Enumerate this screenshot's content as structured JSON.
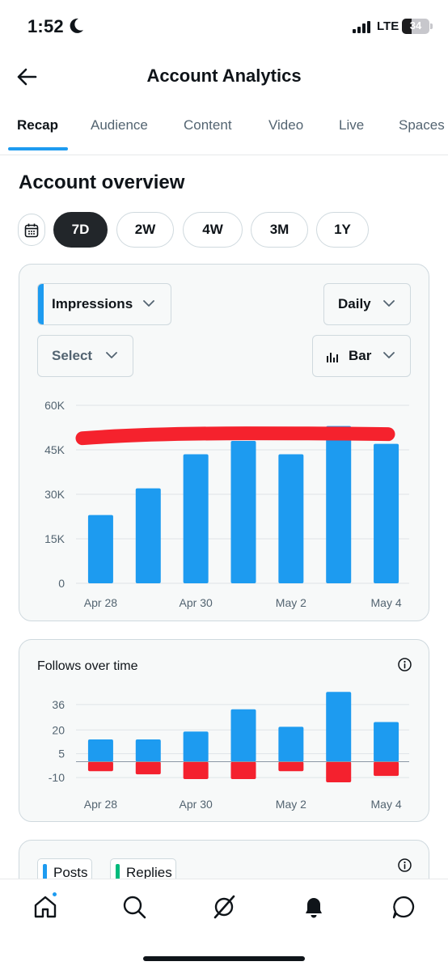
{
  "status_bar": {
    "time": "1:52",
    "network": "LTE",
    "battery": "34",
    "battery_level": 0.34
  },
  "header": {
    "title": "Account Analytics",
    "back_icon": "arrow-left-icon"
  },
  "tabs": [
    {
      "label": "Recap",
      "active": true
    },
    {
      "label": "Audience",
      "active": false
    },
    {
      "label": "Content",
      "active": false
    },
    {
      "label": "Video",
      "active": false
    },
    {
      "label": "Live",
      "active": false
    },
    {
      "label": "Spaces",
      "active": false
    }
  ],
  "overview": {
    "title": "Account overview",
    "ranges": [
      {
        "label": "7D",
        "selected": true
      },
      {
        "label": "2W",
        "selected": false
      },
      {
        "label": "4W",
        "selected": false
      },
      {
        "label": "3M",
        "selected": false
      },
      {
        "label": "1Y",
        "selected": false
      }
    ]
  },
  "impressions_card": {
    "metric_dropdown": "Impressions",
    "interval_dropdown": "Daily",
    "compare_dropdown": "Select",
    "chart_type_dropdown": "Bar"
  },
  "follows_card": {
    "title": "Follows over time"
  },
  "posts_card": {
    "legend": [
      {
        "label": "Posts",
        "color": "#1d9bf0"
      },
      {
        "label": "Replies",
        "color": "#00ba7c"
      }
    ]
  },
  "chart_data": [
    {
      "type": "bar",
      "x_tick_labels": [
        "Apr 28",
        "Apr 30",
        "May 2",
        "May 4"
      ],
      "y_tick_labels": [
        "0",
        "15K",
        "30K",
        "45K",
        "60K"
      ],
      "values": [
        23000,
        32000,
        43500,
        48000,
        43500,
        53000,
        47000
      ],
      "ylim": [
        0,
        60000
      ],
      "grid": true,
      "color": "#1d9bf0",
      "annotation": {
        "type": "red-marker-line",
        "y": 50000,
        "color": "#f5222d"
      }
    },
    {
      "type": "bar",
      "x_tick_labels": [
        "Apr 28",
        "Apr 30",
        "May 2",
        "May 4"
      ],
      "y_tick_labels": [
        "36",
        "20",
        "5",
        "-10"
      ],
      "series": [
        {
          "values": [
            14,
            14,
            19,
            33,
            22,
            44,
            25
          ],
          "color": "#1d9bf0"
        },
        {
          "values": [
            -6,
            -8,
            -11,
            -11,
            -6,
            -13,
            -9
          ],
          "color": "#f4212e"
        }
      ],
      "ylim": [
        -12,
        38
      ],
      "grid": true
    }
  ],
  "bottom_nav": [
    {
      "name": "home-icon",
      "active": true,
      "badge": true
    },
    {
      "name": "search-icon",
      "active": false
    },
    {
      "name": "grok-icon",
      "active": false
    },
    {
      "name": "notifications-icon",
      "active": false
    },
    {
      "name": "messages-icon",
      "active": false
    }
  ]
}
